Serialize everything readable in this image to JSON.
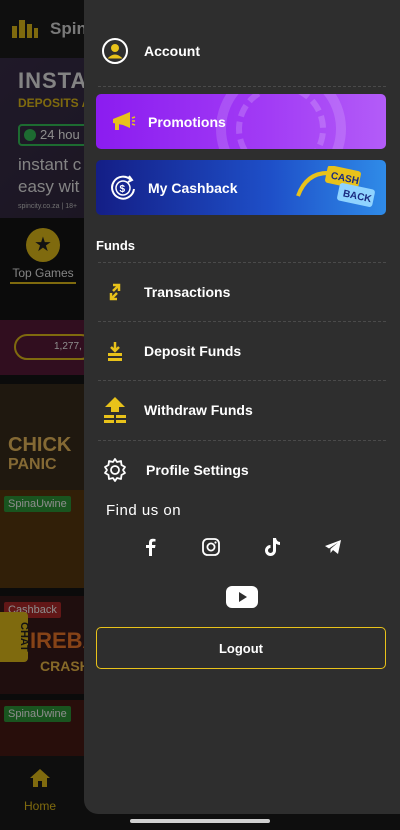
{
  "background": {
    "brand": "Spin",
    "banner": {
      "line1": "INSTAN",
      "line2": "DEPOSITS A",
      "badge": "24 hou",
      "line3": "instant c",
      "line4": "easy wit",
      "footnote": "spincity.co.za | 18+"
    },
    "top_games_label": "Top Games",
    "jackpot_amount": "1,277,",
    "games": [
      {
        "title": "CHICK",
        "subtitle": "PANIC"
      },
      {
        "tag": "SpinaUwine"
      },
      {
        "tag": "Cashback",
        "title": "IREBA",
        "subtitle": "CRASH"
      },
      {
        "tag": "SpinaUwine"
      }
    ],
    "chat_label": "CHAT",
    "home_label": "Home"
  },
  "drawer": {
    "account_label": "Account",
    "promotions_label": "Promotions",
    "cashback_label": "My Cashback",
    "cashback_badge": [
      "CASH",
      "BACK"
    ],
    "funds_title": "Funds",
    "transactions_label": "Transactions",
    "deposit_label": "Deposit Funds",
    "withdraw_label": "Withdraw Funds",
    "profile_settings_label": "Profile Settings",
    "find_us_label": "Find us on",
    "socials": [
      "facebook-icon",
      "instagram-icon",
      "tiktok-icon",
      "telegram-icon",
      "youtube-icon"
    ],
    "logout_label": "Logout"
  },
  "colors": {
    "accent": "#e8c21a",
    "drawer_bg": "#2e2e2e",
    "promotions_bg": "#9b2ff5",
    "cashback_bg": "#1a3aaa"
  }
}
